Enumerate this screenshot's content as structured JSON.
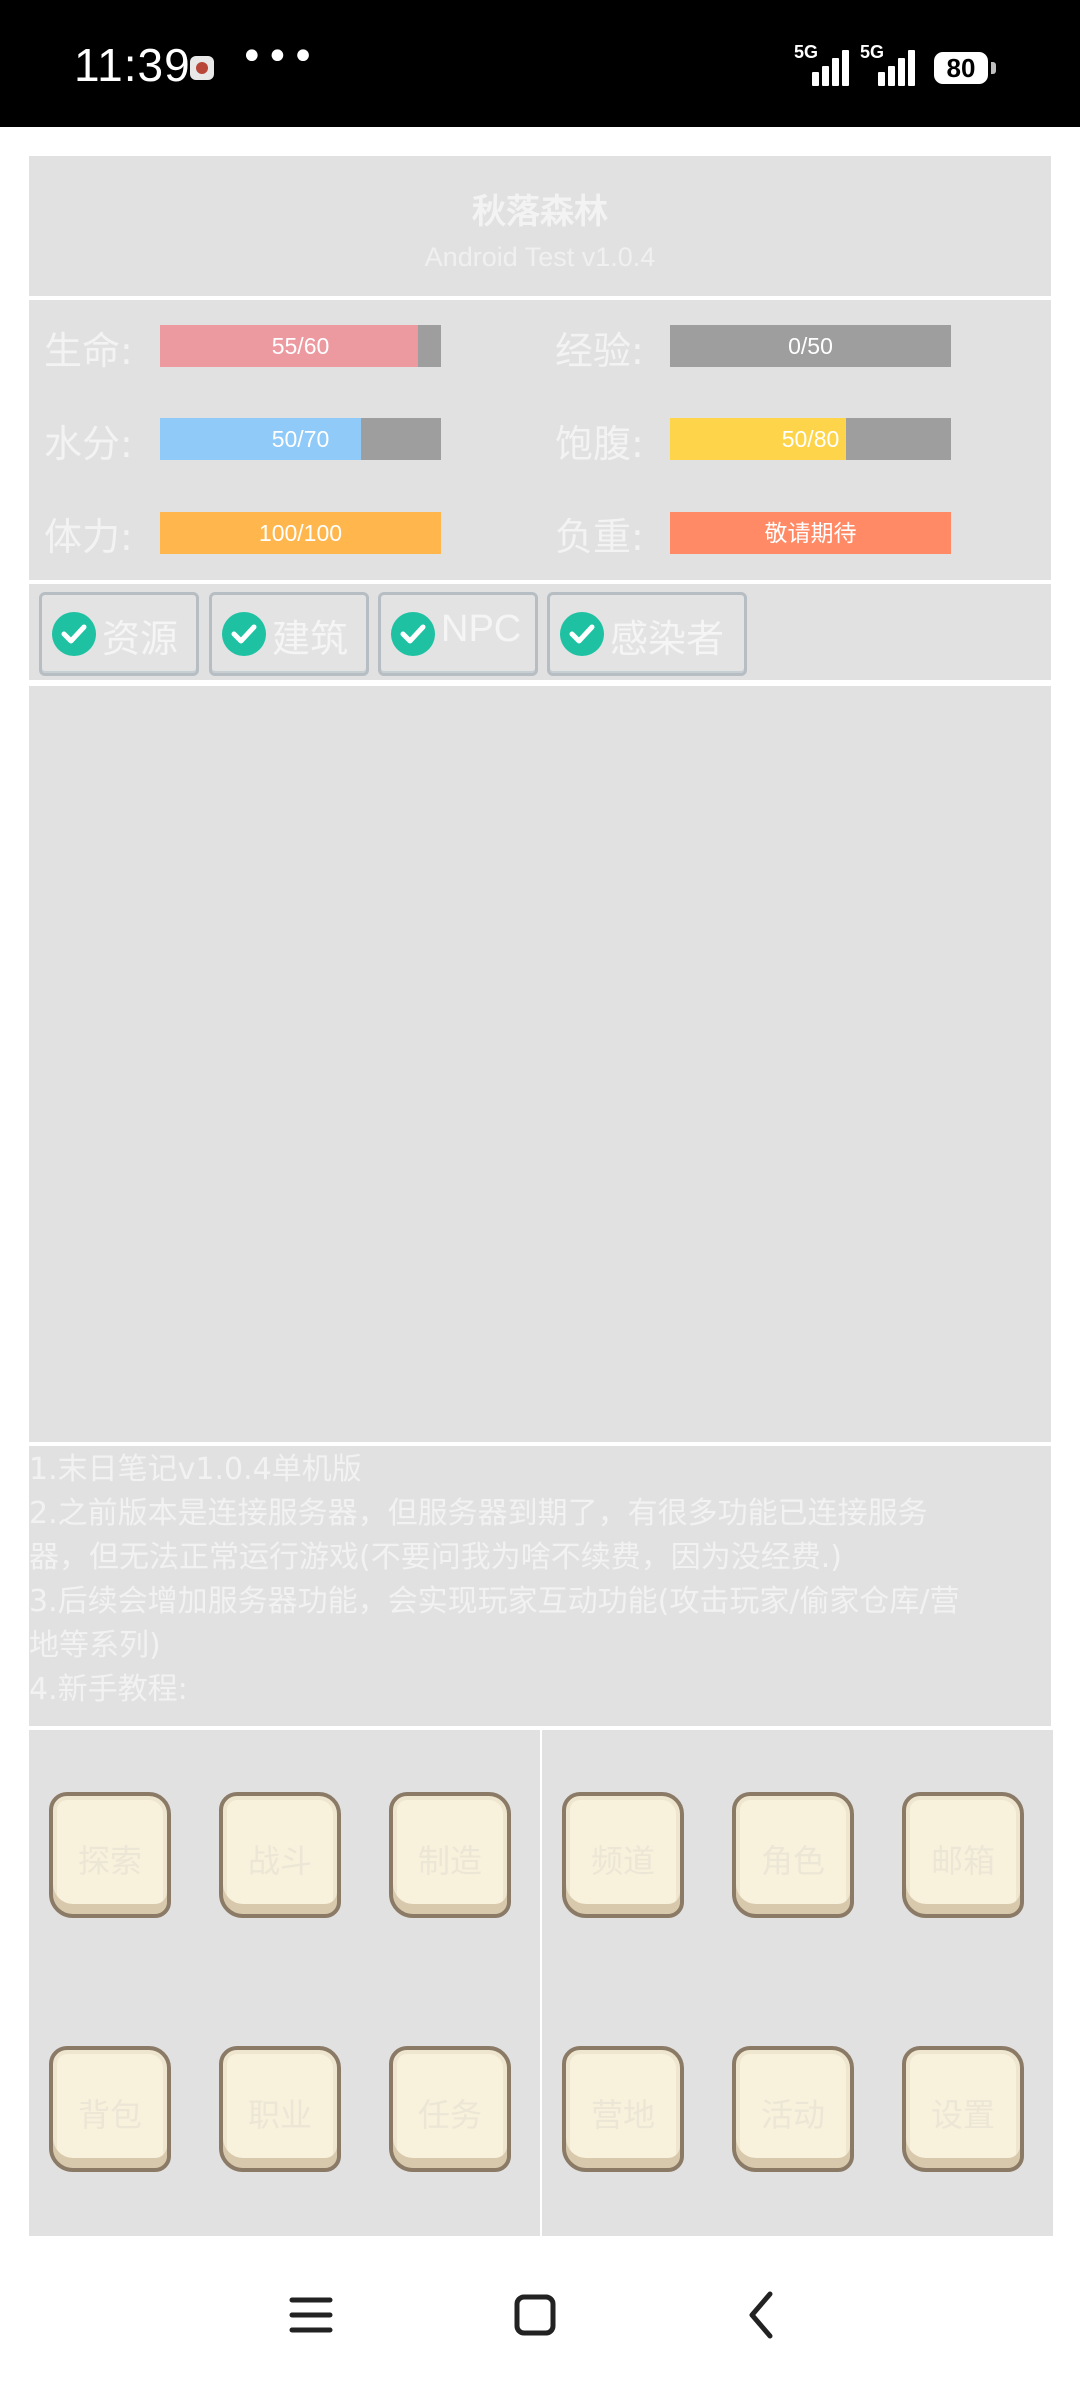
{
  "status_bar": {
    "time": "11:39",
    "more": "•••",
    "signal1_label": "5G",
    "signal2_label": "5G",
    "battery": "80"
  },
  "game": {
    "title": "秋落森林",
    "subtitle": "Android Test v1.0.4"
  },
  "stats": [
    {
      "label": "生命:",
      "text": "55/60",
      "fill": 0.917,
      "color": "#ec9aa0"
    },
    {
      "label": "经验:",
      "text": "0/50",
      "fill": 0.0,
      "color": "#ffffff"
    },
    {
      "label": "水分:",
      "text": "50/70",
      "fill": 0.714,
      "color": "#90caf8"
    },
    {
      "label": "饱腹:",
      "text": "50/80",
      "fill": 0.625,
      "color": "#fed54a"
    },
    {
      "label": "体力:",
      "text": "100/100",
      "fill": 1.0,
      "color": "#ffb74d"
    },
    {
      "label": "负重:",
      "text": "敬请期待",
      "fill": 1.0,
      "color": "#ff8a65"
    }
  ],
  "filters": [
    {
      "label": "资源",
      "checked": true
    },
    {
      "label": "建筑",
      "checked": true
    },
    {
      "label": "NPC",
      "checked": true
    },
    {
      "label": "感染者",
      "checked": true
    }
  ],
  "log": {
    "lines": [
      "1.末日笔记v1.0.4单机版",
      "2.之前版本是连接服务器，但服务器到期了，有很多功能已连接服务",
      "器，但无法正常运行游戏(不要问我为啥不续费，因为没经费.)",
      "3.后续会增加服务器功能，会实现玩家互动功能(攻击玩家/偷家仓库/营",
      "地等系列)",
      "4.新手教程:"
    ]
  },
  "actions_left": [
    {
      "label": "探索"
    },
    {
      "label": "战斗"
    },
    {
      "label": "制造"
    },
    {
      "label": "背包"
    },
    {
      "label": "职业"
    },
    {
      "label": "任务"
    }
  ],
  "actions_right": [
    {
      "label": "频道"
    },
    {
      "label": "角色"
    },
    {
      "label": "邮箱"
    },
    {
      "label": "营地"
    },
    {
      "label": "活动"
    },
    {
      "label": "设置"
    }
  ],
  "nav": {
    "menu_icon": "menu-icon",
    "home_icon": "square-home-icon",
    "back_icon": "chevron-back-icon"
  }
}
